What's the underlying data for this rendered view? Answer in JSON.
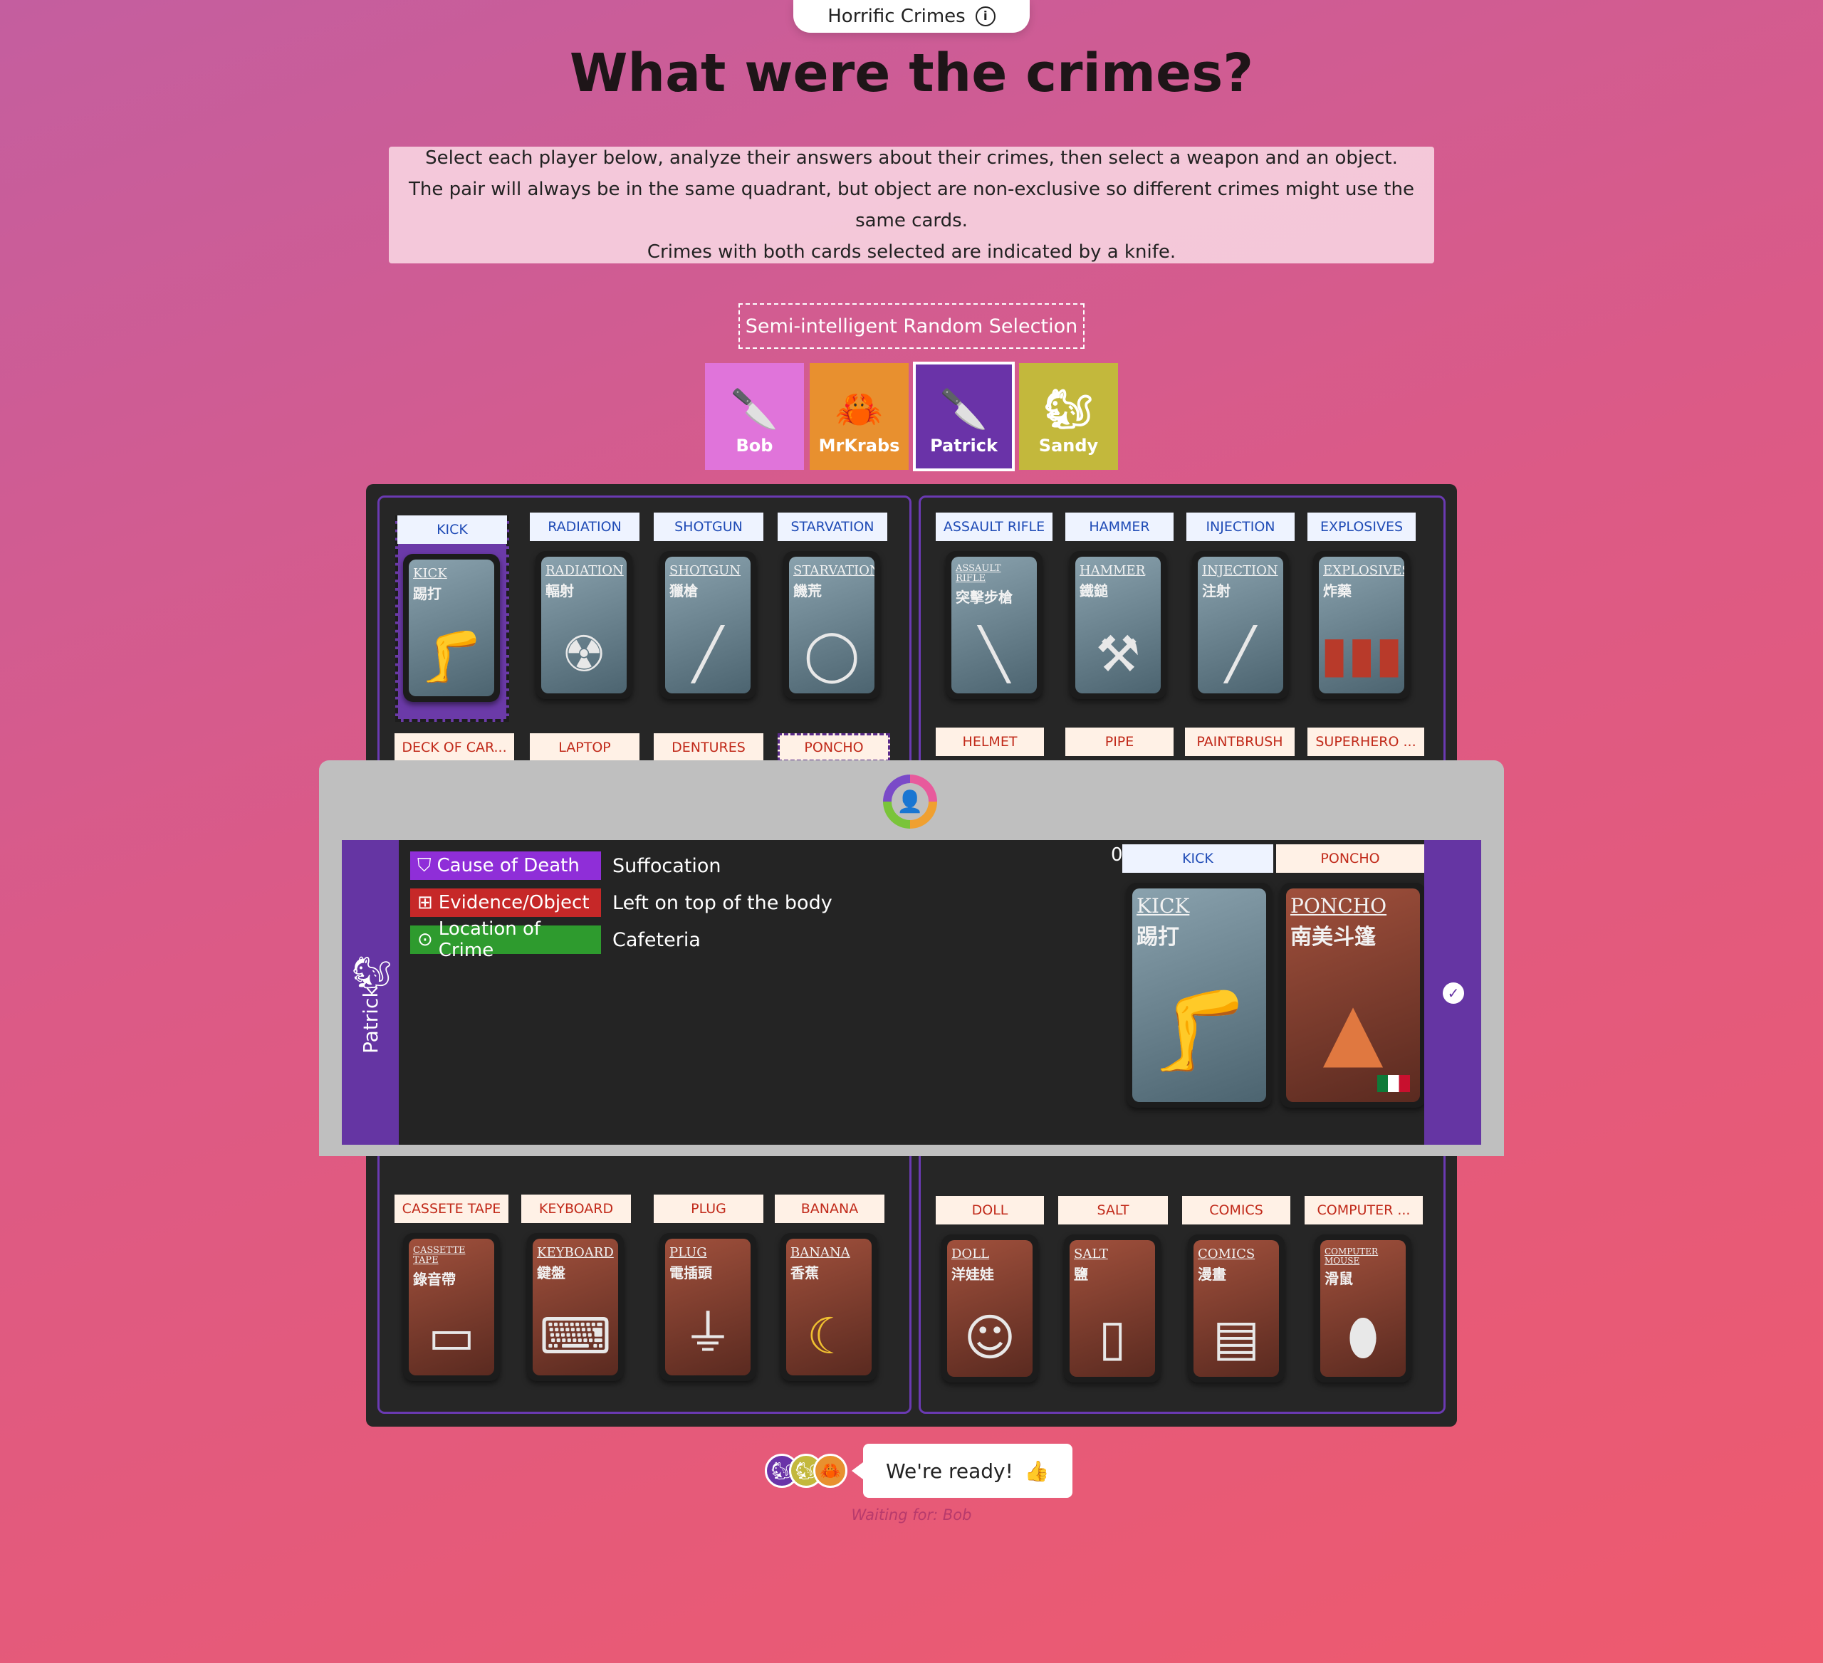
{
  "header": {
    "title": "Horrific Crimes",
    "info_icon": "info-icon"
  },
  "page_title": "What were the crimes?",
  "instructions": [
    "Select each player below, analyze their answers about their crimes, then select a weapon and an object.",
    "The pair will always be in the same quadrant, but object are non-exclusive so different crimes might use the same cards.",
    "Crimes with both cards selected are indicated by a knife."
  ],
  "random_selection_label": "Semi-intelligent Random Selection",
  "players": [
    {
      "name": "Bob",
      "color": "#e074da",
      "icon": "knife-icon"
    },
    {
      "name": "MrKrabs",
      "color": "#e8902f",
      "icon": "crab-icon"
    },
    {
      "name": "Patrick",
      "color": "#6a33a8",
      "icon": "knife-icon",
      "active": true
    },
    {
      "name": "Sandy",
      "color": "#c3b83c",
      "icon": "squirrel-icon"
    }
  ],
  "quadrant_top_left": {
    "weapons": [
      {
        "label": "KICK",
        "en": "KICK",
        "zh": "踢打"
      },
      {
        "label": "RADIATION",
        "en": "RADIATION",
        "zh": "輻射"
      },
      {
        "label": "SHOTGUN",
        "en": "SHOTGUN",
        "zh": "獵槍"
      },
      {
        "label": "STARVATION",
        "en": "STARVATION",
        "zh": "饑荒"
      }
    ],
    "objects": [
      "DECK OF CAR...",
      "LAPTOP",
      "DENTURES",
      "PONCHO"
    ]
  },
  "quadrant_top_right": {
    "weapons": [
      {
        "label": "ASSAULT RIFLE",
        "en": "ASSAULT RIFLE",
        "zh": "突擊步槍"
      },
      {
        "label": "HAMMER",
        "en": "HAMMER",
        "zh": "鐵鎚"
      },
      {
        "label": "INJECTION",
        "en": "INJECTION",
        "zh": "注射"
      },
      {
        "label": "EXPLOSIVES",
        "en": "EXPLOSIVES",
        "zh": "炸藥"
      }
    ],
    "objects": [
      "HELMET",
      "PIPE",
      "PAINTBRUSH",
      "SUPERHERO ..."
    ]
  },
  "quadrant_bottom_left": {
    "objects": [
      {
        "label": "CASSETE TAPE",
        "en": "CASSETTE TAPE",
        "zh": "錄音帶"
      },
      {
        "label": "KEYBOARD",
        "en": "KEYBOARD",
        "zh": "鍵盤"
      },
      {
        "label": "PLUG",
        "en": "PLUG",
        "zh": "電插頭"
      },
      {
        "label": "BANANA",
        "en": "BANANA",
        "zh": "香蕉"
      }
    ]
  },
  "quadrant_bottom_right": {
    "objects": [
      {
        "label": "DOLL",
        "en": "DOLL",
        "zh": "洋娃娃"
      },
      {
        "label": "SALT",
        "en": "SALT",
        "zh": "鹽"
      },
      {
        "label": "COMICS",
        "en": "COMICS",
        "zh": "漫畫"
      },
      {
        "label": "COMPUTER ...",
        "en": "COMPUTER MOUSE",
        "zh": "滑鼠"
      }
    ]
  },
  "crime_panel": {
    "player": "Patrick",
    "clues": [
      {
        "label": "Cause of Death",
        "value": "Suffocation",
        "color": "#8f2ed8",
        "icon": "shield-icon"
      },
      {
        "label": "Evidence/Object",
        "value": "Left on top of the body",
        "color": "#c62828",
        "icon": "gift-icon"
      },
      {
        "label": "Location of Crime",
        "value": "Cafeteria",
        "color": "#2e9b2e",
        "icon": "map-pin-icon"
      }
    ],
    "count": "0",
    "selected_weapon": {
      "label": "KICK",
      "en": "KICK",
      "zh": "踢打"
    },
    "selected_object": {
      "label": "PONCHO",
      "en": "PONCHO",
      "zh": "南美斗篷"
    }
  },
  "ready_button": {
    "label": "We're ready!",
    "icon": "thumbs-up-icon"
  },
  "waiting_text": "Waiting for: Bob"
}
